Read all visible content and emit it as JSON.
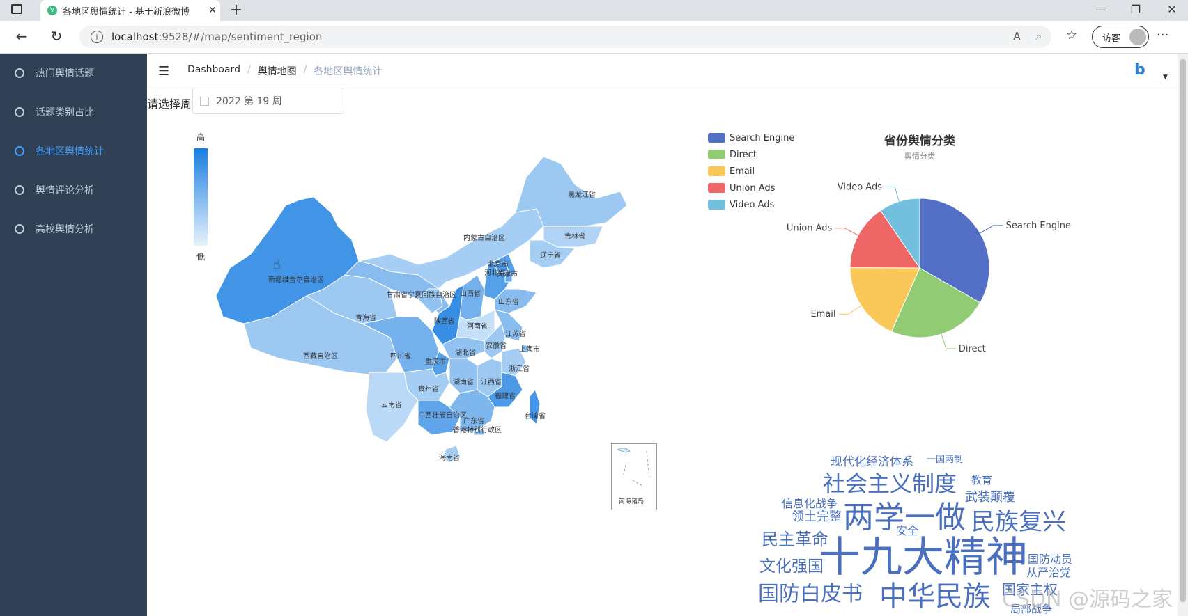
{
  "browser": {
    "tab_title": "各地区舆情统计 - 基于新浪微博",
    "url_host": "localhost",
    "url_path": ":9528/#/map/sentiment_region",
    "guest_label": "访客"
  },
  "sidebar": {
    "items": [
      {
        "label": "热门舆情话题",
        "active": false
      },
      {
        "label": "话题类别占比",
        "active": false
      },
      {
        "label": "各地区舆情统计",
        "active": true
      },
      {
        "label": "舆情评论分析",
        "active": false
      },
      {
        "label": "高校舆情分析",
        "active": false
      }
    ]
  },
  "breadcrumb": [
    "Dashboard",
    "舆情地图",
    "各地区舆情统计"
  ],
  "week_picker": {
    "label": "请选择周",
    "value": "2022 第 19 周"
  },
  "map": {
    "visual_map": {
      "high": "高",
      "low": "低"
    },
    "south_sea_label": "南海诸岛",
    "provinces": [
      {
        "name": "新疆维吾尔自治区",
        "level": 0.8
      },
      {
        "name": "西藏自治区",
        "level": 0.35
      },
      {
        "name": "青海省",
        "level": 0.35
      },
      {
        "name": "甘肃省",
        "level": 0.45
      },
      {
        "name": "内蒙古自治区",
        "level": 0.3
      },
      {
        "name": "黑龙江省",
        "level": 0.35
      },
      {
        "name": "吉林省",
        "level": 0.25
      },
      {
        "name": "辽宁省",
        "level": 0.3
      },
      {
        "name": "宁夏回族自治区",
        "level": 0.4
      },
      {
        "name": "陕西省",
        "level": 0.85
      },
      {
        "name": "山西省",
        "level": 0.55
      },
      {
        "name": "河北省",
        "level": 0.7
      },
      {
        "name": "北京市",
        "level": 0.75
      },
      {
        "name": "天津市",
        "level": 0.6
      },
      {
        "name": "山东省",
        "level": 0.45
      },
      {
        "name": "河南省",
        "level": 0.15
      },
      {
        "name": "江苏省",
        "level": 0.45
      },
      {
        "name": "安徽省",
        "level": 0.35
      },
      {
        "name": "上海市",
        "level": 0.4
      },
      {
        "name": "湖北省",
        "level": 0.4
      },
      {
        "name": "四川省",
        "level": 0.55
      },
      {
        "name": "重庆市",
        "level": 0.7
      },
      {
        "name": "浙江省",
        "level": 0.3
      },
      {
        "name": "湖南省",
        "level": 0.4
      },
      {
        "name": "江西省",
        "level": 0.35
      },
      {
        "name": "贵州省",
        "level": 0.3
      },
      {
        "name": "福建省",
        "level": 0.75
      },
      {
        "name": "云南省",
        "level": 0.2
      },
      {
        "name": "广西壮族自治区",
        "level": 0.65
      },
      {
        "name": "广东省",
        "level": 0.5
      },
      {
        "name": "台湾省",
        "level": 0.8
      },
      {
        "name": "海南省",
        "level": 0.3
      },
      {
        "name": "香港特别行政区",
        "level": 0.5
      }
    ]
  },
  "chart_data": {
    "type": "pie",
    "title": "省份舆情分类",
    "subtitle": "舆情分类",
    "legend_position": "top-left",
    "series": [
      {
        "name": "Search Engine",
        "value": 1048,
        "color": "#5470c6"
      },
      {
        "name": "Direct",
        "value": 735,
        "color": "#91cc75"
      },
      {
        "name": "Email",
        "value": 580,
        "color": "#fac858"
      },
      {
        "name": "Union Ads",
        "value": 484,
        "color": "#ee6666"
      },
      {
        "name": "Video Ads",
        "value": 300,
        "color": "#73c0de"
      }
    ]
  },
  "word_cloud": [
    {
      "text": "现代化经济体系",
      "size": 17
    },
    {
      "text": "一国两制",
      "size": 13
    },
    {
      "text": "社会主义制度",
      "size": 32
    },
    {
      "text": "教育",
      "size": 15
    },
    {
      "text": "信息化战争",
      "size": 16
    },
    {
      "text": "武装颠覆",
      "size": 18
    },
    {
      "text": "领土完整",
      "size": 18
    },
    {
      "text": "两学一做",
      "size": 44
    },
    {
      "text": "民族复兴",
      "size": 34
    },
    {
      "text": "民主革命",
      "size": 24
    },
    {
      "text": "安全",
      "size": 16
    },
    {
      "text": "文化强国",
      "size": 23
    },
    {
      "text": "十九大精神",
      "size": 60
    },
    {
      "text": "国防动员",
      "size": 16
    },
    {
      "text": "从严治党",
      "size": 16
    },
    {
      "text": "国防白皮书",
      "size": 30
    },
    {
      "text": "中华民族",
      "size": 40
    },
    {
      "text": "国家主权",
      "size": 20
    },
    {
      "text": "局部战争",
      "size": 15
    }
  ],
  "watermark": "CSDN @源码之家"
}
